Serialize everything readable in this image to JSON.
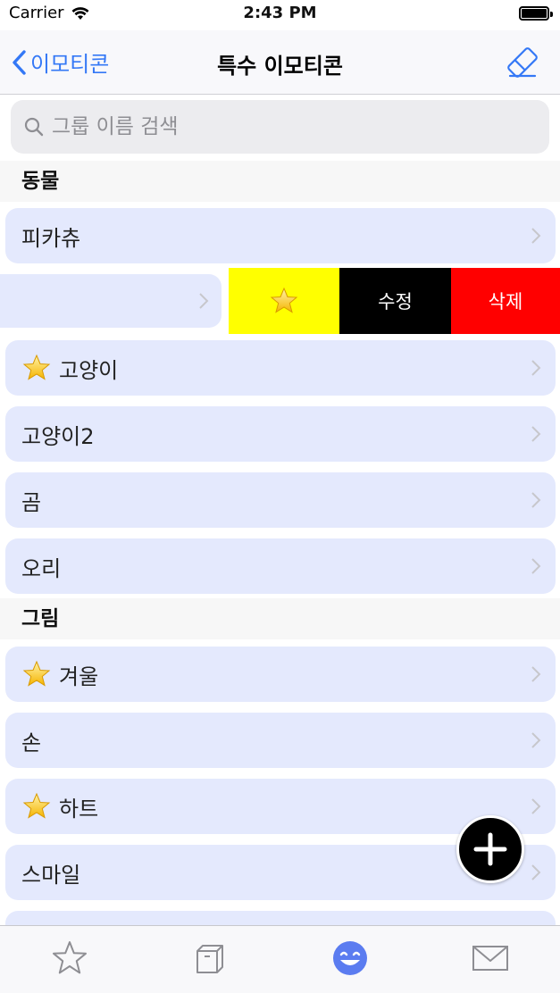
{
  "status_bar": {
    "carrier": "Carrier",
    "time": "2:43 PM"
  },
  "nav": {
    "back_label": "이모티콘",
    "title": "특수 이모티콘",
    "accent_color": "#3478f6"
  },
  "search": {
    "placeholder": "그룹 이름 검색",
    "value": ""
  },
  "sections": [
    {
      "title": "동물"
    },
    {
      "title": "그림"
    }
  ],
  "rows": {
    "pikachu": {
      "label": "피카츄",
      "favorite": false
    },
    "swiped": {
      "label": "",
      "favorite": false
    },
    "cat": {
      "label": "고양이",
      "favorite": true
    },
    "cat2": {
      "label": "고양이2",
      "favorite": false
    },
    "bear": {
      "label": "곰",
      "favorite": false
    },
    "duck": {
      "label": "오리",
      "favorite": false
    },
    "winter": {
      "label": "겨울",
      "favorite": true
    },
    "hand": {
      "label": "손",
      "favorite": false
    },
    "heart": {
      "label": "하트",
      "favorite": true
    },
    "smile": {
      "label": "스마일",
      "favorite": false
    }
  },
  "swipe_actions": {
    "favorite_icon": "star-icon",
    "edit_label": "수정",
    "delete_label": "삭제",
    "favorite_color": "#ffff00",
    "edit_color": "#000000",
    "delete_color": "#ff0000"
  },
  "tab_bar": {
    "tabs": [
      {
        "icon": "star-outline-icon",
        "selected": false
      },
      {
        "icon": "box-icon",
        "selected": false
      },
      {
        "icon": "smiley-icon",
        "selected": true
      },
      {
        "icon": "mail-icon",
        "selected": false
      }
    ],
    "selected_color": "#5b7cf0",
    "unselected_color": "#8e8e93"
  },
  "row_color": "#e4e9fd"
}
